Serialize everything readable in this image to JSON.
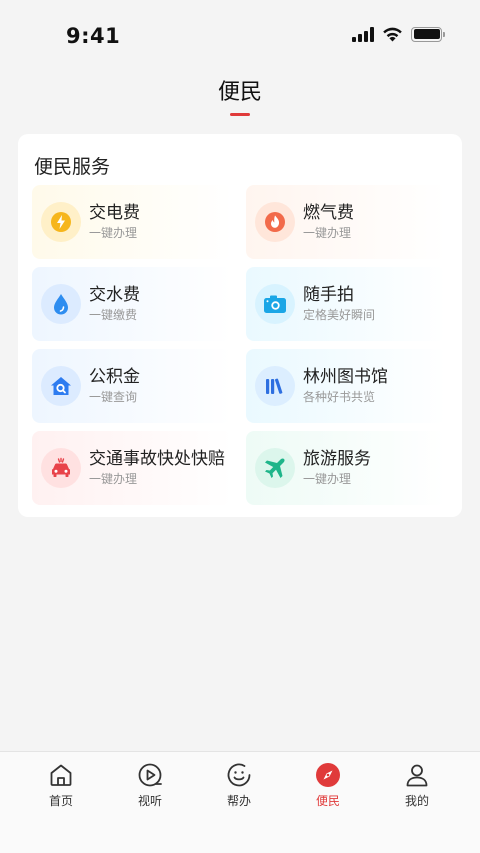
{
  "status": {
    "time": "9:41"
  },
  "header": {
    "title": "便民",
    "accent": "#e03a3a"
  },
  "section": {
    "title": "便民服务",
    "items": [
      {
        "name": "交电费",
        "sub": "一键办理",
        "icon": "lightning-icon"
      },
      {
        "name": "燃气费",
        "sub": "一键办理",
        "icon": "flame-icon"
      },
      {
        "name": "交水费",
        "sub": "一键缴费",
        "icon": "water-drop-icon"
      },
      {
        "name": "随手拍",
        "sub": "定格美好瞬间",
        "icon": "camera-icon"
      },
      {
        "name": "公积金",
        "sub": "一键查询",
        "icon": "house-search-icon"
      },
      {
        "name": "林州图书馆",
        "sub": "各种好书共览",
        "icon": "books-icon"
      },
      {
        "name": "交通事故快处快赔",
        "sub": "一键办理",
        "icon": "car-accident-icon"
      },
      {
        "name": "旅游服务",
        "sub": "一键办理",
        "icon": "airplane-icon"
      }
    ]
  },
  "tabbar": {
    "active": "便民",
    "items": [
      {
        "label": "首页",
        "icon": "home-icon"
      },
      {
        "label": "视听",
        "icon": "play-icon"
      },
      {
        "label": "帮办",
        "icon": "smile-icon"
      },
      {
        "label": "便民",
        "icon": "compass-icon"
      },
      {
        "label": "我的",
        "icon": "user-icon"
      }
    ]
  }
}
